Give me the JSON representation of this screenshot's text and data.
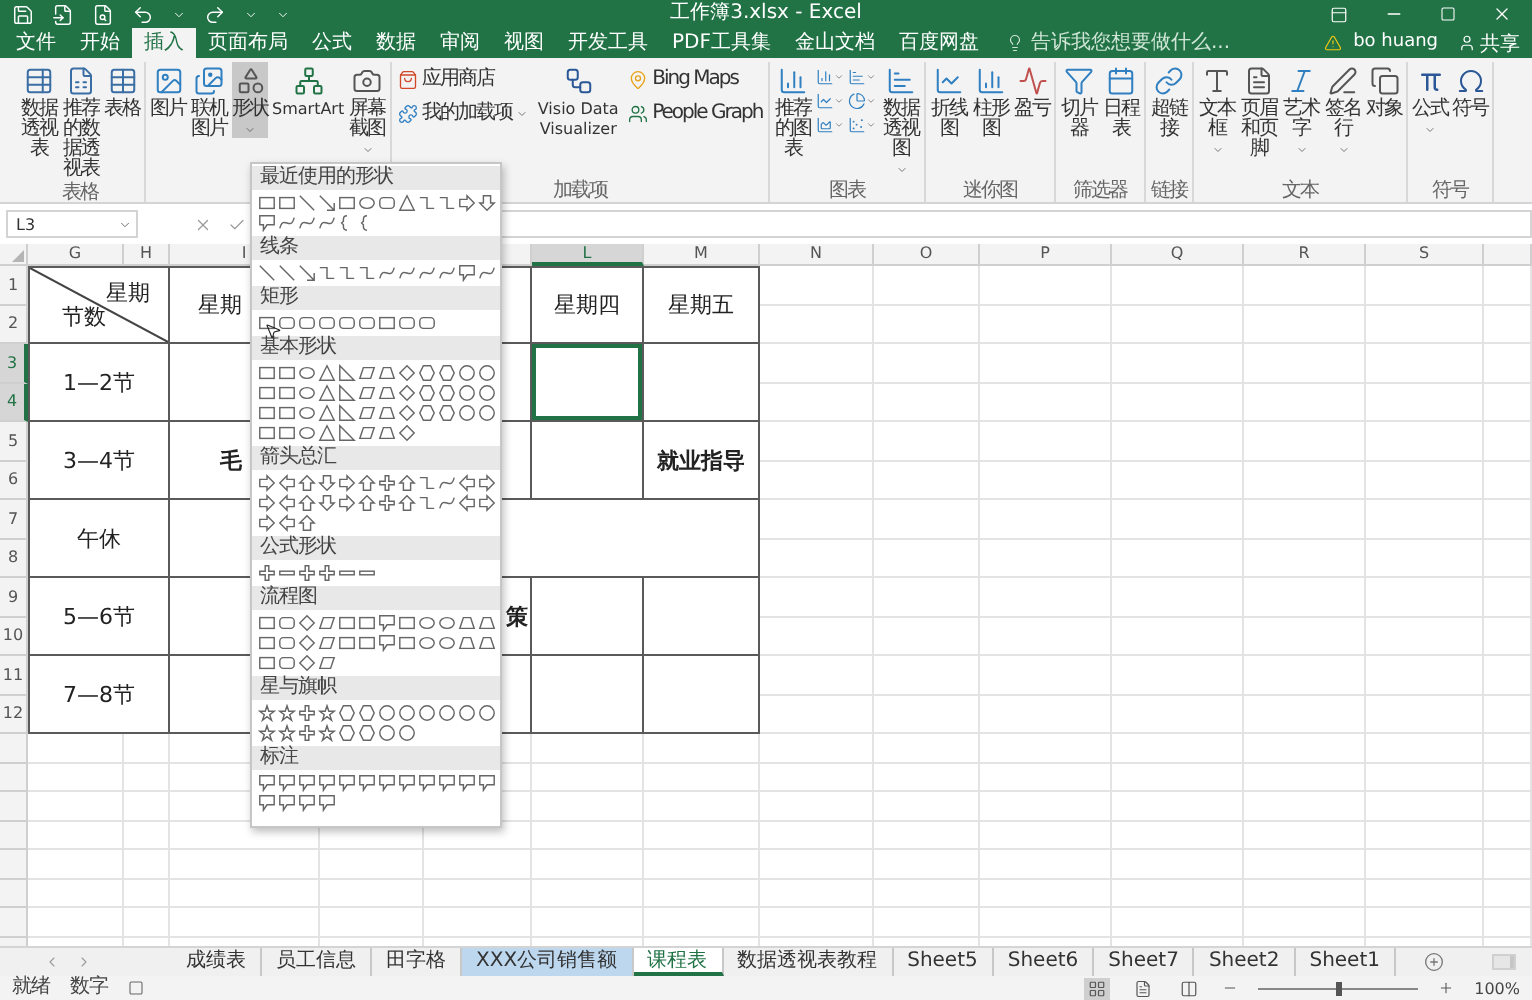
{
  "title_bar": {
    "title": "工作簿3.xlsx - Excel"
  },
  "ribbon_tabs": [
    {
      "label": "文件",
      "selected": false
    },
    {
      "label": "开始",
      "selected": false
    },
    {
      "label": "插入",
      "selected": true
    },
    {
      "label": "页面布局",
      "selected": false
    },
    {
      "label": "公式",
      "selected": false
    },
    {
      "label": "数据",
      "selected": false
    },
    {
      "label": "审阅",
      "selected": false
    },
    {
      "label": "视图",
      "selected": false
    },
    {
      "label": "开发工具",
      "selected": false
    },
    {
      "label": "PDF工具集",
      "selected": false
    },
    {
      "label": "金山文档",
      "selected": false
    },
    {
      "label": "百度网盘",
      "selected": false
    }
  ],
  "tell_me": {
    "placeholder": "告诉我您想要做什么..."
  },
  "user": {
    "name": "bo huang"
  },
  "share": {
    "label": "共享"
  },
  "ribbon_groups": [
    {
      "label": "表格",
      "items": [
        {
          "kind": "large",
          "label": "数据透视表",
          "menu": false,
          "pressed": false
        },
        {
          "kind": "large",
          "label": "推荐的数据透视表",
          "menu": false,
          "pressed": false
        },
        {
          "kind": "large",
          "label": "表格",
          "menu": false,
          "pressed": false
        }
      ]
    },
    {
      "items": [
        {
          "kind": "large",
          "label": "图片",
          "menu": false,
          "pressed": false
        },
        {
          "kind": "large",
          "label": "联机图片",
          "menu": false,
          "pressed": false
        },
        {
          "kind": "large",
          "label": "形状",
          "menu": true,
          "pressed": true
        },
        {
          "kind": "large-wide",
          "label": "SmartArt",
          "menu": false,
          "pressed": false
        },
        {
          "kind": "large",
          "label": "屏幕截图",
          "menu": true,
          "pressed": false
        }
      ]
    },
    {
      "label": "加载项",
      "items": [
        {
          "kind": "stack",
          "buttons": [
            {
              "label": "应用商店",
              "menu": false
            },
            {
              "label": "我的加载项",
              "menu": true
            }
          ]
        },
        {
          "kind": "large-wide",
          "label": "Visio Data Visualizer",
          "menu": false,
          "pressed": false
        },
        {
          "kind": "stack",
          "buttons": [
            {
              "label": "Bing Maps",
              "menu": false
            },
            {
              "label": "People Graph",
              "menu": false
            }
          ]
        }
      ]
    },
    {
      "label": "图表",
      "items": [
        {
          "kind": "large",
          "label": "推荐的图表",
          "menu": false,
          "pressed": false
        },
        {
          "kind": "icons"
        },
        {
          "kind": "large",
          "label": "数据透视图",
          "menu": true,
          "pressed": false
        }
      ]
    },
    {
      "label": "迷你图",
      "items": [
        {
          "kind": "large",
          "label": "折线图",
          "menu": false,
          "pressed": false
        },
        {
          "kind": "large",
          "label": "柱形图",
          "menu": false,
          "pressed": false
        },
        {
          "kind": "large",
          "label": "盈亏",
          "menu": false,
          "pressed": false
        }
      ]
    },
    {
      "label": "筛选器",
      "items": [
        {
          "kind": "large",
          "label": "切片器",
          "menu": false,
          "pressed": false
        },
        {
          "kind": "large",
          "label": "日程表",
          "menu": false,
          "pressed": false
        }
      ]
    },
    {
      "label": "链接",
      "items": [
        {
          "kind": "large",
          "label": "超链接",
          "menu": false,
          "pressed": false
        }
      ]
    },
    {
      "label": "文本",
      "items": [
        {
          "kind": "large",
          "label": "文本框",
          "menu": true,
          "pressed": false
        },
        {
          "kind": "large",
          "label": "页眉和页脚",
          "menu": false,
          "pressed": false
        },
        {
          "kind": "large",
          "label": "艺术字",
          "menu": true,
          "pressed": false
        },
        {
          "kind": "large",
          "label": "签名行",
          "menu": true,
          "pressed": false
        },
        {
          "kind": "large",
          "label": "对象",
          "menu": false,
          "pressed": false
        }
      ]
    },
    {
      "label": "符号",
      "items": [
        {
          "kind": "large",
          "label": "公式",
          "menu": true,
          "pressed": false
        },
        {
          "kind": "large",
          "label": "符号",
          "menu": false,
          "pressed": false
        }
      ]
    }
  ],
  "formula_bar": {
    "name_box": "L3"
  },
  "shape_gallery": {
    "sections": [
      {
        "title": "最近使用的形状"
      },
      {
        "title": "线条"
      },
      {
        "title": "矩形"
      },
      {
        "title": "基本形状"
      },
      {
        "title": "箭头总汇"
      },
      {
        "title": "公式形状"
      },
      {
        "title": "流程图"
      },
      {
        "title": "星与旗帜"
      },
      {
        "title": "标注"
      }
    ]
  },
  "column_headers_left": [
    {
      "label": "G",
      "selected": false
    },
    {
      "label": "H",
      "selected": false
    },
    {
      "label": "I",
      "selected": false
    }
  ],
  "column_headers_right": [
    {
      "label": "L",
      "selected": true
    },
    {
      "label": "M",
      "selected": false
    },
    {
      "label": "N",
      "selected": false
    },
    {
      "label": "O",
      "selected": false
    },
    {
      "label": "P",
      "selected": false
    },
    {
      "label": "Q",
      "selected": false
    },
    {
      "label": "R",
      "selected": false
    },
    {
      "label": "S",
      "selected": false
    }
  ],
  "row_headers": [
    {
      "label": "1",
      "selected": false
    },
    {
      "label": "2",
      "selected": false
    },
    {
      "label": "3",
      "selected": true
    },
    {
      "label": "4",
      "selected": true
    },
    {
      "label": "5",
      "selected": false
    },
    {
      "label": "6",
      "selected": false
    },
    {
      "label": "7",
      "selected": false
    },
    {
      "label": "8",
      "selected": false
    },
    {
      "label": "9",
      "selected": false
    },
    {
      "label": "10",
      "selected": false
    },
    {
      "label": "11",
      "selected": false
    },
    {
      "label": "12",
      "selected": false
    }
  ],
  "schedule": {
    "rows": [
      {
        "cells": [
          {
            "kind": "diagonal",
            "top": "星期",
            "bottom": "节数",
            "bold": false,
            "selected": false
          },
          {
            "kind": "text",
            "text": "星期",
            "bold": false,
            "selected": false
          },
          {
            "kind": "text"
          },
          {
            "kind": "text",
            "selected": false
          },
          {
            "kind": "text",
            "text": "星期四",
            "bold": false,
            "selected": false
          },
          {
            "kind": "text",
            "text": "星期五",
            "bold": false,
            "selected": false
          }
        ]
      },
      {
        "cells": [
          {
            "kind": "text",
            "text": "1—2节",
            "bold": false,
            "selected": false
          },
          {
            "kind": "text",
            "selected": false
          },
          {
            "kind": "text"
          },
          {
            "kind": "text",
            "selected": false
          },
          {
            "kind": "text",
            "selected": true
          },
          {
            "kind": "text",
            "selected": false
          }
        ]
      },
      {
        "cells": [
          {
            "kind": "text",
            "text": "3—4节",
            "bold": false,
            "selected": false
          },
          {
            "kind": "text",
            "text": "毛",
            "bold": true,
            "selected": false
          },
          {
            "kind": "text"
          },
          {
            "kind": "text",
            "selected": false
          },
          {
            "kind": "text",
            "selected": false
          },
          {
            "kind": "text",
            "text": "就业指导",
            "bold": true,
            "selected": false
          }
        ]
      },
      {
        "cells": [
          {
            "kind": "text",
            "text": "午休",
            "bold": false,
            "selected": false
          },
          {
            "kind": "text",
            "selected": false
          }
        ]
      },
      {
        "cells": [
          {
            "kind": "text",
            "text": "5—6节",
            "bold": false,
            "selected": false
          },
          {
            "kind": "text",
            "selected": false
          },
          {
            "kind": "text"
          },
          {
            "kind": "text",
            "text": "策",
            "bold": true,
            "selected": false
          },
          {
            "kind": "text",
            "selected": false
          },
          {
            "kind": "text",
            "selected": false
          }
        ]
      },
      {
        "cells": [
          {
            "kind": "text",
            "text": "7—8节",
            "bold": false,
            "selected": false
          },
          {
            "kind": "text",
            "selected": false
          },
          {
            "kind": "text"
          },
          {
            "kind": "text",
            "selected": false
          },
          {
            "kind": "text",
            "selected": false
          },
          {
            "kind": "text",
            "selected": false
          }
        ]
      }
    ]
  },
  "sheet_tabs": [
    {
      "label": "成绩表",
      "selected": false
    },
    {
      "label": "员工信息",
      "selected": false
    },
    {
      "label": "田字格",
      "selected": false
    },
    {
      "label": "XXX公司销售额",
      "selected": false,
      "color": "#bdd7ee"
    },
    {
      "label": "课程表",
      "selected": true
    },
    {
      "label": "数据透视表教程",
      "selected": false
    },
    {
      "label": "Sheet5",
      "selected": false
    },
    {
      "label": "Sheet6",
      "selected": false
    },
    {
      "label": "Sheet7",
      "selected": false
    },
    {
      "label": "Sheet2",
      "selected": false
    },
    {
      "label": "Sheet1",
      "selected": false
    }
  ],
  "status_bar": {
    "items": [
      "就绪",
      "数字"
    ],
    "views": [
      {
        "selected": true
      },
      {
        "selected": false
      },
      {
        "selected": false
      }
    ],
    "zoom_slider": {
      "level": 0.5
    },
    "zoom": "100%"
  }
}
